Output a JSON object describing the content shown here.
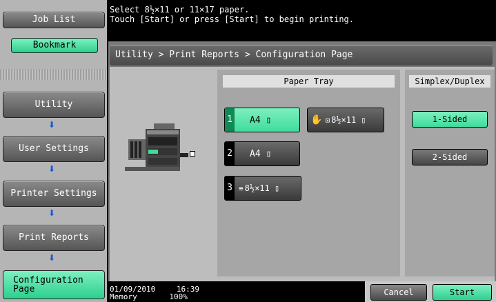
{
  "sidebar": {
    "job_list": "Job List",
    "bookmark": "Bookmark",
    "items": [
      {
        "label": "Utility"
      },
      {
        "label": "User Settings"
      },
      {
        "label": "Printer Settings"
      },
      {
        "label": "Print Reports"
      },
      {
        "label": "Configuration Page"
      }
    ]
  },
  "message": {
    "line1": "Select 8½×11 or 11×17 paper.",
    "line2": "Touch [Start] or press [Start] to begin printing."
  },
  "breadcrumb": "Utility > Print Reports > Configuration Page",
  "paper_tray": {
    "header": "Paper Tray",
    "trays": [
      {
        "num": "1",
        "label": "A4 ▯",
        "selected": true
      },
      {
        "num": "",
        "label": "8½×11 ▯",
        "selected": false
      },
      {
        "num": "2",
        "label": "A4 ▯",
        "selected": false
      },
      {
        "num": "3",
        "label": "8½×11 ▯",
        "selected": false
      }
    ]
  },
  "simplex_duplex": {
    "header": "Simplex/Duplex",
    "one_sided": "1-Sided",
    "two_sided": "2-Sided"
  },
  "footer": {
    "date": "01/09/2010",
    "time": "16:39",
    "memory_label": "Memory",
    "memory_value": "100%",
    "cancel": "Cancel",
    "start": "Start"
  },
  "colors": {
    "accent_green": "#3fdc9c",
    "arrow_blue": "#1556d6"
  }
}
